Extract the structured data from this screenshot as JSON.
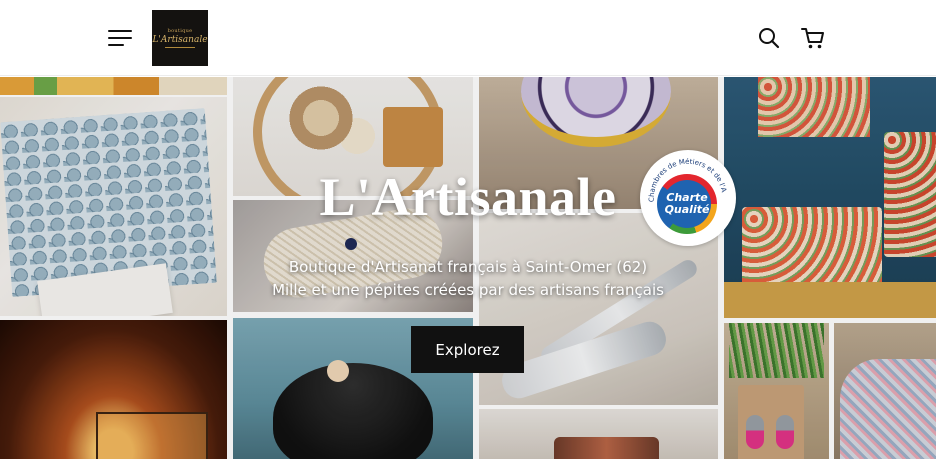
{
  "header": {
    "menu_icon": "hamburger-menu-icon",
    "logo": {
      "small_text": "boutique",
      "main_text": "L'Artisanale"
    },
    "search_icon": "search-icon",
    "cart_icon": "cart-icon"
  },
  "hero": {
    "title": "L'Artisanale",
    "subtitle_line1": "Boutique d'Artisanat français à Saint-Omer (62)",
    "subtitle_line2": "Mille et une pépites créées par des artisans français",
    "cta_label": "Explorez"
  },
  "badge": {
    "ring_text": "Chambres de Métiers et de l'Artisanat",
    "line1": "Charte",
    "line2": "Qualité"
  },
  "colors": {
    "header_bg": "#ffffff",
    "cta_bg": "#111111",
    "text_light": "#ffffff",
    "badge_blue": "#1f63b0"
  }
}
